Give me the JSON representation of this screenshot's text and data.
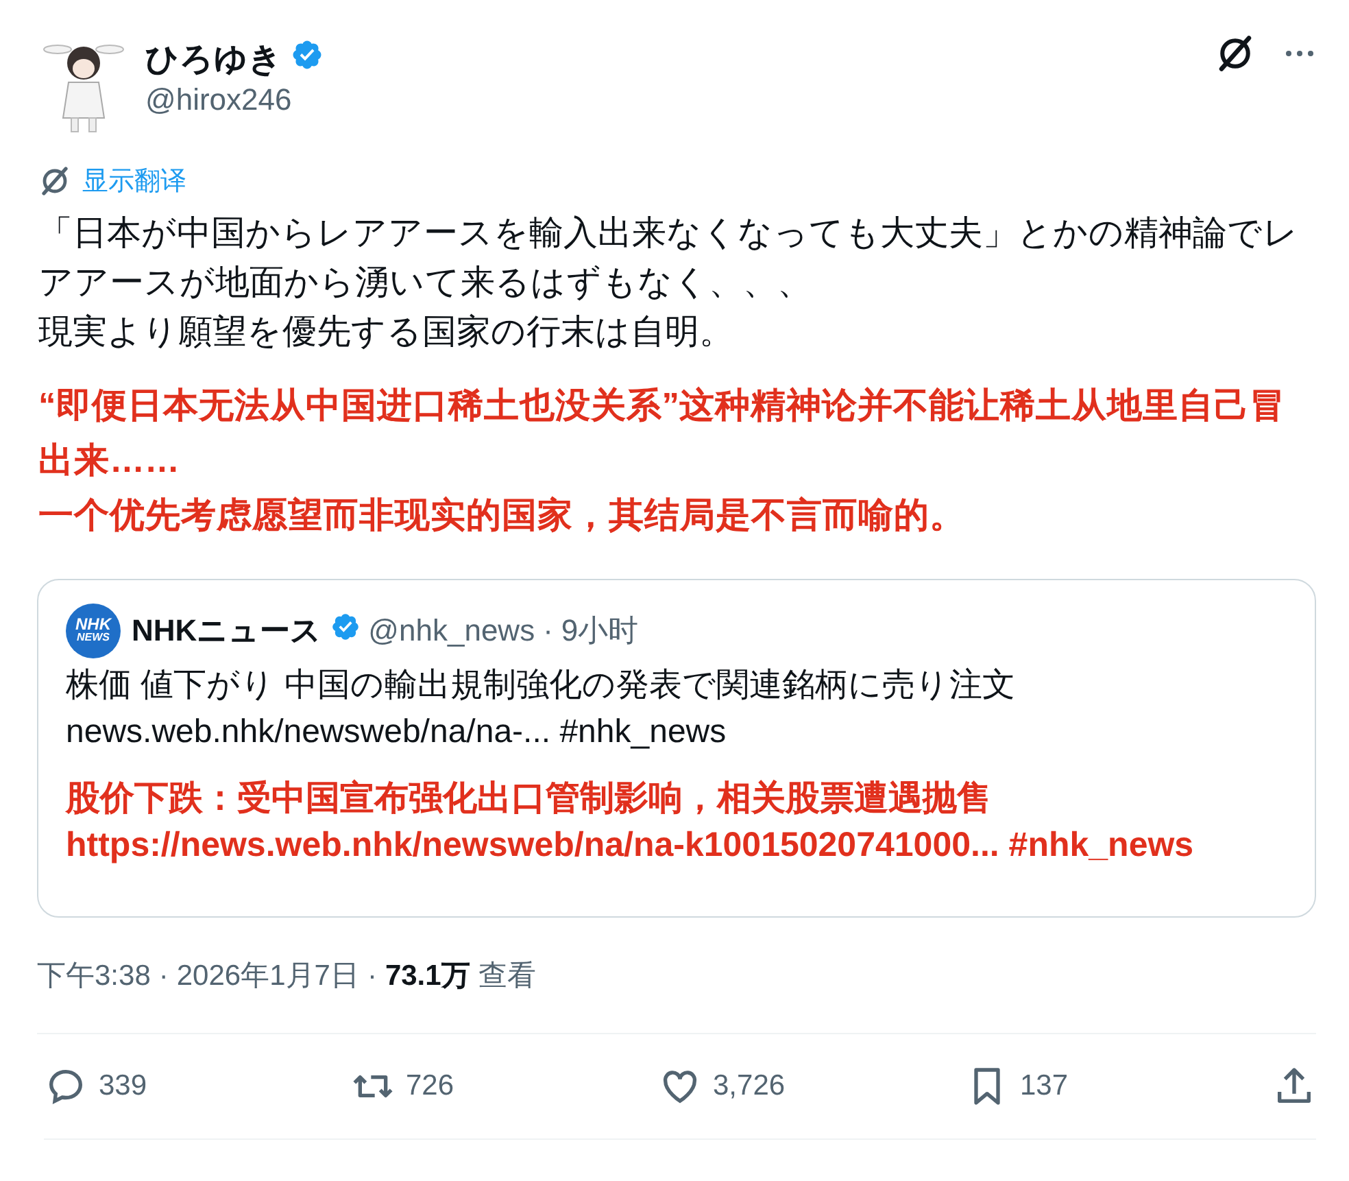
{
  "author": {
    "name": "ひろゆき",
    "handle": "@hirox246",
    "verified": true
  },
  "translate_link": "显示翻译",
  "post_text": [
    "「日本が中国からレアアースを輸入出来なくなっても大丈夫」とかの精神論でレアアースが地面から湧いて来るはずもなく、、、",
    "現実より願望を優先する国家の行末は自明。"
  ],
  "translation_text": [
    "“即便日本无法从中国进口稀土也没关系”这种精神论并不能让稀土从地里自己冒出来……",
    "一个优先考虑愿望而非现实的国家，其结局是不言而喻的。"
  ],
  "quote": {
    "logo_text": [
      "NHK",
      "NEWS"
    ],
    "name": "NHKニュース",
    "verified": true,
    "handle": "@nhk_news",
    "separator": "·",
    "time": "9小时",
    "text": [
      "株価 値下がり 中国の輸出規制強化の発表で関連銘柄に売り注文",
      "news.web.nhk/newsweb/na/na-... #nhk_news"
    ],
    "translation_text": [
      "股价下跌：受中国宣布强化出口管制影响，相关股票遭遇抛售",
      "https://news.web.nhk/newsweb/na/na-k10015020741000... #nhk_news"
    ]
  },
  "meta": {
    "time": "下午3:38",
    "separator": "·",
    "date": "2026年1月7日",
    "views": "73.1万",
    "views_label": "查看"
  },
  "actions": [
    {
      "kind": "reply",
      "count": "339"
    },
    {
      "kind": "repost",
      "count": "726"
    },
    {
      "kind": "like",
      "count": "3,726"
    },
    {
      "kind": "bookmark",
      "count": "137"
    },
    {
      "kind": "share"
    }
  ]
}
